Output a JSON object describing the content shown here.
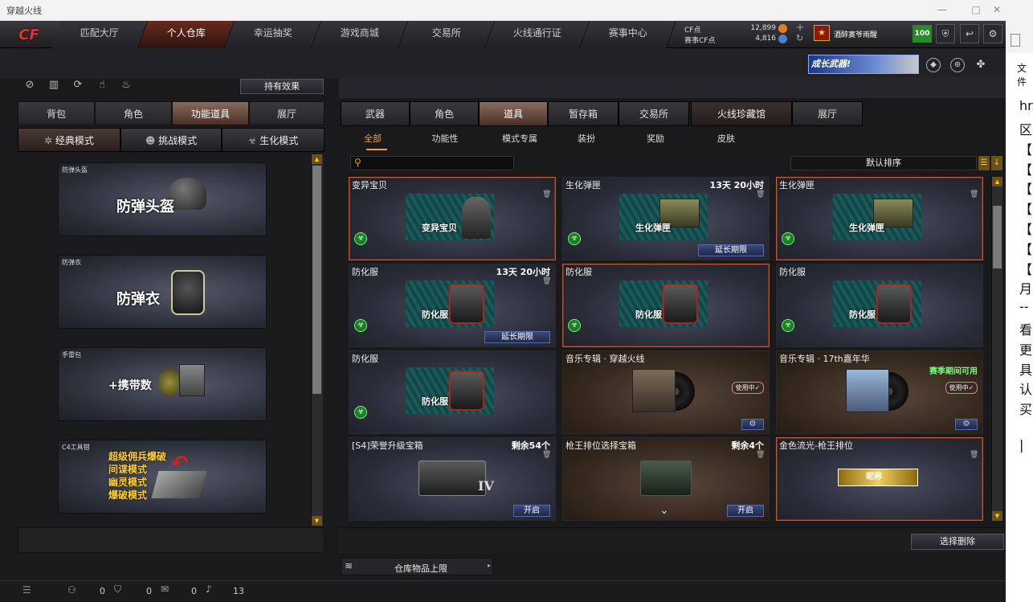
{
  "window": {
    "title": "穿越火线",
    "controls": [
      "—",
      "□",
      "✕"
    ]
  },
  "logo": "CF",
  "nav_tabs": [
    "匹配大厅",
    "个人仓库",
    "幸运抽奖",
    "游戏商城",
    "交易所",
    "火线通行证",
    "赛事中心"
  ],
  "nav_active": "个人仓库",
  "currency": [
    {
      "label": "CF点",
      "value": "12,899"
    },
    {
      "label": "赛事CF点",
      "value": "4,816"
    }
  ],
  "user": {
    "name": "酒醉寞爷雨醒",
    "level": "100"
  },
  "banner": {
    "text": "成长武器!"
  },
  "left": {
    "effects_button": "持有效果",
    "tabs": [
      "背包",
      "角色",
      "功能道具",
      "展厅"
    ],
    "active_tab": "功能道具",
    "modes": [
      "经典模式",
      "挑战模式",
      "生化模式"
    ],
    "active_mode": "经典模式",
    "cards": [
      {
        "caption": "防弹头盔",
        "big": "防弹头盔"
      },
      {
        "caption": "防弹衣",
        "big": "防弹衣"
      },
      {
        "caption": "手雷包",
        "big": "+携带数"
      },
      {
        "caption": "C4工具钳",
        "lines": [
          "超级佣兵爆破",
          "间谍模式",
          "幽灵模式",
          "爆破模式"
        ]
      }
    ]
  },
  "right": {
    "tabs": [
      "武器",
      "角色",
      "道具",
      "暂存箱",
      "交易所",
      "火线珍藏馆",
      "展厅"
    ],
    "active_tab": "道具",
    "filters": [
      "全部",
      "功能性",
      "模式专属",
      "装扮",
      "奖励",
      "皮肤"
    ],
    "active_filter": "全部",
    "search_placeholder": "",
    "sort_label": "默认排序",
    "items": [
      {
        "name": "变异宝贝",
        "art": "变异宝贝",
        "selected": true
      },
      {
        "name": "生化弹匣",
        "time": "13天 20小时",
        "art": "生化弹匣",
        "button": "延长期限"
      },
      {
        "name": "生化弹匣",
        "art": "生化弹匣",
        "selected": true
      },
      {
        "name": "防化服",
        "time": "13天 20小时",
        "art": "防化服",
        "button": "延长期限"
      },
      {
        "name": "防化服",
        "art": "防化服",
        "selected": true
      },
      {
        "name": "防化服",
        "art": "防化服"
      },
      {
        "name": "防化服",
        "art": "防化服"
      },
      {
        "name": "音乐专辑 · 穿越火线",
        "status": "使用中✓",
        "music": true
      },
      {
        "name": "音乐专辑 · 17th嘉年华",
        "status": "使用中✓",
        "season": "赛季期间可用",
        "music": true
      },
      {
        "name": "[S4]荣誉升级宝箱",
        "time": "剩余54个",
        "button": "开启",
        "mark": "IV"
      },
      {
        "name": "枪王排位选择宝箱",
        "time": "剩余4个",
        "button": "开启"
      },
      {
        "name": "金色流光-枪王排位",
        "badge": "昵称",
        "selected": true
      }
    ],
    "delete_button": "选择删除",
    "storage_limit": "仓库物品上限"
  },
  "bottom": {
    "values": [
      "0",
      "0",
      "0",
      "13"
    ]
  },
  "side_strip": {
    "header": "文件",
    "lines": [
      "hr",
      "区",
      "【",
      "【",
      "【",
      "【",
      "【",
      "【",
      "【",
      "月",
      "--",
      "看",
      "更",
      "具",
      "认",
      "买",
      "|"
    ]
  }
}
